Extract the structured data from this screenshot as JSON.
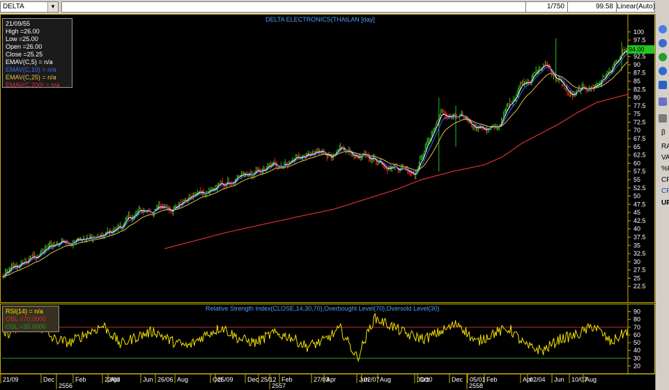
{
  "toolbar": {
    "symbol": "DELTA",
    "page_indicator": "1/750",
    "last_value": "99.58",
    "scale_mode": "Linear(Auto)"
  },
  "price_panel": {
    "title": "DELTA ELECTRONICS(THAILAN [day]",
    "current_price_tag": "94.00",
    "legend": {
      "date": "21/09/55",
      "high": "High  =26.00",
      "low": "Low   =25.00",
      "open": "Open  =26.00",
      "close": "Close  =25.25",
      "emav5": "EMAV(C,5)    = n/a",
      "emav10": "EMAV(C,10)    = n/a",
      "emav25": "EMAV(C,25)    = n/a",
      "emav200": "EMAV(C,200)   = n/a"
    },
    "colors": {
      "emav5": "#ffffff",
      "emav10": "#3a6bff",
      "emav25": "#e8c04a",
      "emav200": "#e03030",
      "up": "#22c522",
      "down": "#e02020"
    }
  },
  "rsi_panel": {
    "title": "Relative Strength Index(CLOSE,14,30,70),Overbought Level(70),Oversold Level(30)",
    "legend": {
      "rsi": "RSI(14)  = n/a",
      "obl": "OBL    =70.0000",
      "osl": "OSL    =30.0000"
    },
    "colors": {
      "rsi": "#f5e400",
      "obl": "#c03030",
      "osl": "#1e9e1e"
    }
  },
  "x_axis_labels": [
    "21/09",
    "Dec",
    "2556",
    "Feb",
    "22/03",
    "Apr",
    "Jun",
    "26/06",
    "Aug",
    "Oct",
    "25/09",
    "Dec",
    "25/12",
    "2557",
    "Feb",
    "27/03",
    "Apr",
    "Jun",
    "02/07",
    "Aug",
    "01/10",
    "Oct",
    "Dec",
    "05/01",
    "2558",
    "Feb",
    "02/04",
    "Apr",
    "Jun",
    "10/07",
    "Aug"
  ],
  "sidebar": {
    "labels": [
      "RA",
      "VA",
      "%F",
      "CP",
      "CF",
      "UF"
    ],
    "beta": "β"
  },
  "chart_data": [
    {
      "type": "line",
      "title": "DELTA ELECTRONICS(THAILAN [day]",
      "ylim": [
        20,
        102.5
      ],
      "y_ticks": [
        22.5,
        25,
        27.5,
        30,
        32.5,
        35,
        37.5,
        40,
        42.5,
        45,
        47.5,
        50,
        52.5,
        55,
        57.5,
        60,
        62.5,
        65,
        67.5,
        70,
        72.5,
        75,
        77.5,
        80,
        82.5,
        85,
        87.5,
        90,
        92.5,
        95,
        97.5,
        100
      ],
      "x": [
        "21/09/55",
        "12/2555",
        "22/03/56",
        "26/06/56",
        "25/09/56",
        "25/12/56",
        "27/03/57",
        "02/07/57",
        "01/10/57",
        "05/01/58",
        "02/04/58",
        "10/07/58",
        "10/58"
      ],
      "series": [
        {
          "name": "Close",
          "values": [
            25.25,
            30,
            37,
            37,
            45,
            47,
            52,
            56,
            62,
            63,
            61,
            58,
            75,
            72,
            70,
            85,
            90,
            80,
            84,
            94
          ]
        },
        {
          "name": "EMAV(C,200)",
          "values": [
            34,
            36,
            39,
            41.5,
            44,
            46,
            49,
            52,
            55,
            57.5,
            59.5,
            62,
            66,
            69,
            72,
            75.5,
            78.5,
            80,
            81
          ]
        }
      ],
      "candle_anchors_x": [
        0,
        0.04,
        0.1,
        0.16,
        0.22,
        0.27,
        0.33,
        0.4,
        0.47,
        0.54,
        0.6,
        0.66,
        0.7,
        0.75,
        0.79,
        0.83,
        0.87,
        0.91,
        0.95,
        1.0
      ],
      "ema200_anchors_x": [
        0.26,
        0.3,
        0.36,
        0.42,
        0.48,
        0.53,
        0.58,
        0.63,
        0.67,
        0.72,
        0.77,
        0.8,
        0.83,
        0.86,
        0.89,
        0.92,
        0.95,
        0.98,
        1.0
      ]
    },
    {
      "type": "line",
      "title": "Relative Strength Index(CLOSE,14,30,70),Overbought Level(70),Oversold Level(30)",
      "ylim": [
        15,
        95
      ],
      "y_ticks": [
        20,
        30,
        40,
        50,
        60,
        70,
        80,
        90
      ],
      "series": [
        {
          "name": "RSI(14)",
          "values": [
            60,
            68,
            75,
            55,
            50,
            62,
            72,
            48,
            58,
            65,
            52,
            45,
            60,
            70,
            55,
            50,
            62,
            58,
            45,
            52,
            68,
            30,
            82,
            72,
            60,
            55,
            65,
            75,
            50,
            62,
            68,
            45,
            40,
            55,
            60,
            72,
            50,
            66
          ]
        }
      ],
      "levels": {
        "overbought": 70,
        "oversold": 30
      }
    }
  ]
}
